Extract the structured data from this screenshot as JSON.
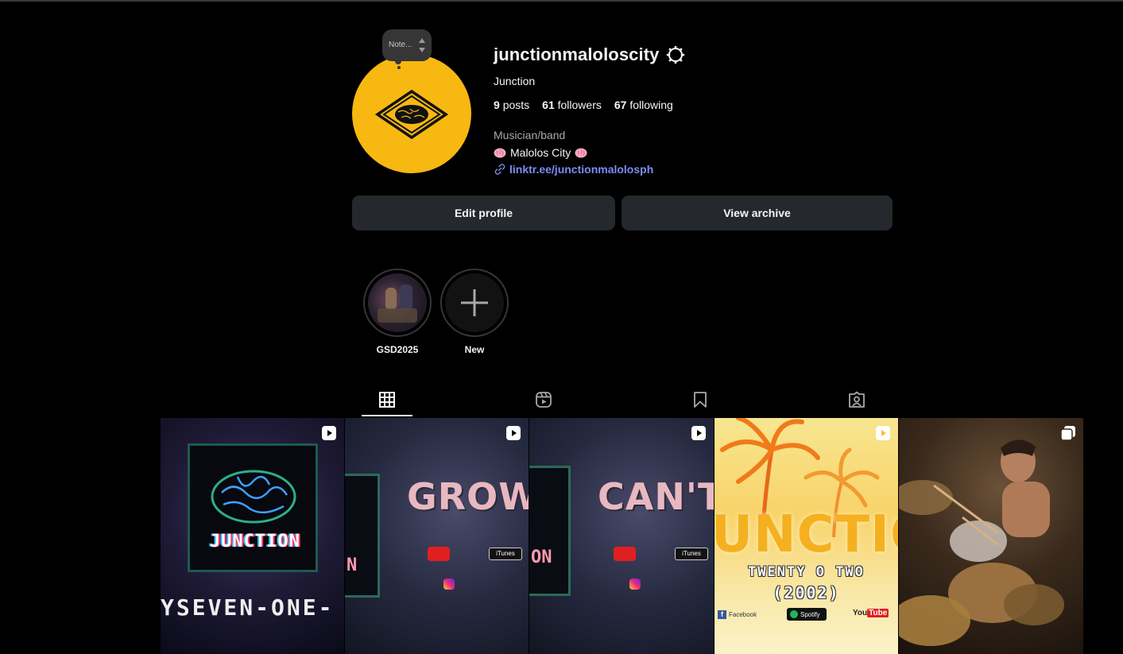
{
  "profile": {
    "username": "junctionmaloloscity",
    "full_name": "Junction",
    "note_label": "Note...",
    "category": "Musician/band",
    "bio": "Malolos City",
    "link": "linktr.ee/junctionmalolosph",
    "avatar_color": "#f7b812"
  },
  "stats": {
    "posts_count": "9",
    "posts_label": "posts",
    "followers_count": "61",
    "followers_label": "followers",
    "following_count": "67",
    "following_label": "following"
  },
  "actions": {
    "edit_profile": "Edit profile",
    "view_archive": "View archive"
  },
  "highlights": [
    {
      "label": "GSD2025",
      "icon": "highlight-thumbnail"
    },
    {
      "label": "New",
      "icon": "plus-icon"
    }
  ],
  "tabs": [
    {
      "name": "posts",
      "icon": "grid-icon",
      "active": true
    },
    {
      "name": "reels",
      "icon": "reels-icon",
      "active": false
    },
    {
      "name": "saved",
      "icon": "bookmark-icon",
      "active": false
    },
    {
      "name": "tagged",
      "icon": "tagged-icon",
      "active": false
    }
  ],
  "posts": [
    {
      "type": "reel",
      "title_text": "JUNCTION",
      "caption_text": "YSEVEN-ONE-"
    },
    {
      "type": "reel",
      "title_text": "GROWN",
      "side_text": "N",
      "platform_text": "iTunes"
    },
    {
      "type": "reel",
      "title_text": "CAN'T H",
      "side_text": "ON",
      "platform_text": "iTunes"
    },
    {
      "type": "reel",
      "title_text": "UNCTIO",
      "subtitle": "TWENTY O TWO",
      "year": "(2002)",
      "facebook_text": "Facebook",
      "spotify_text": "Spotify",
      "youtube_you": "You",
      "youtube_tube": "Tube"
    },
    {
      "type": "carousel",
      "title_text": ""
    }
  ]
}
